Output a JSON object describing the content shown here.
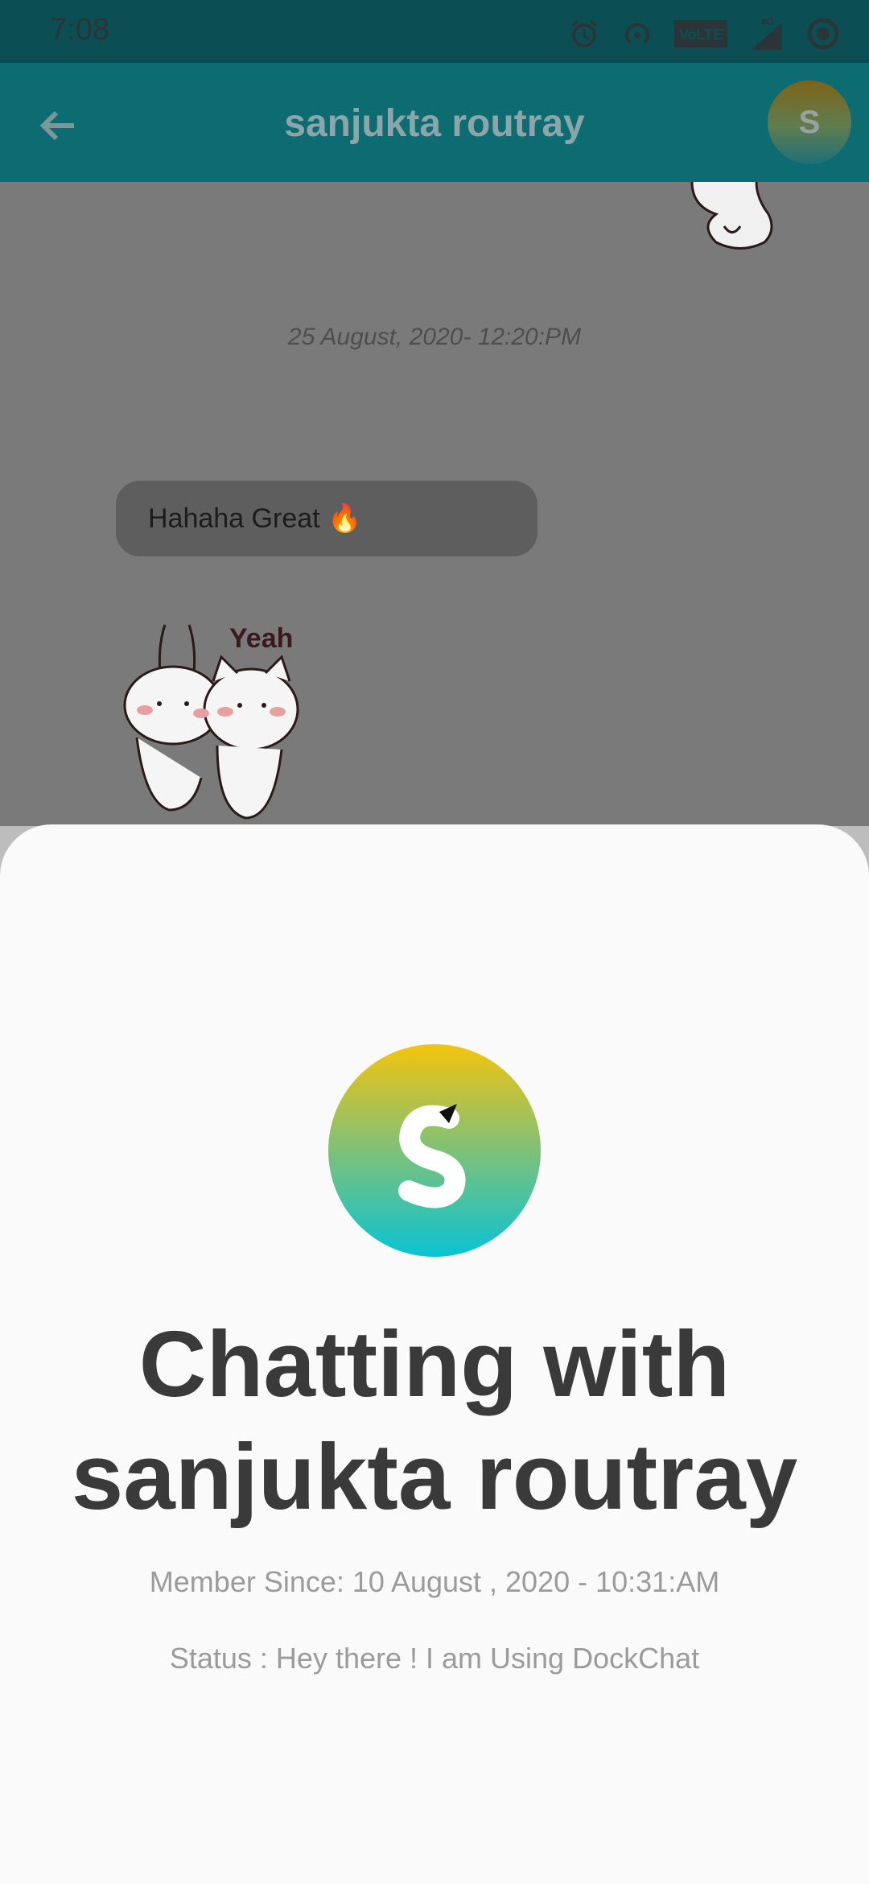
{
  "status_bar": {
    "time": "7:08",
    "icons": [
      "alarm-icon",
      "hotspot-icon",
      "volte-icon",
      "signal-4g-icon",
      "record-icon"
    ],
    "volte_label": "VoLTE",
    "network_label": "4G"
  },
  "app_bar": {
    "title": "sanjukta routray",
    "avatar_letter": "S",
    "colors": {
      "bar": "#0d6b72",
      "title": "#8aa6a8"
    }
  },
  "chat": {
    "date_divider": "25 August, 2020- 12:20:PM",
    "message_text": "Hahaha Great 🔥",
    "sticker_caption": "Yeah"
  },
  "profile_sheet": {
    "title_line1": "Chatting with",
    "title_line2": "sanjukta routray",
    "member_since": "Member Since: 10 August , 2020 - 10:31:AM",
    "status": "Status : Hey there ! I am Using DockChat",
    "avatar_gradient": [
      "#f4c40c",
      "#8ac16f",
      "#0ac3d4"
    ]
  }
}
